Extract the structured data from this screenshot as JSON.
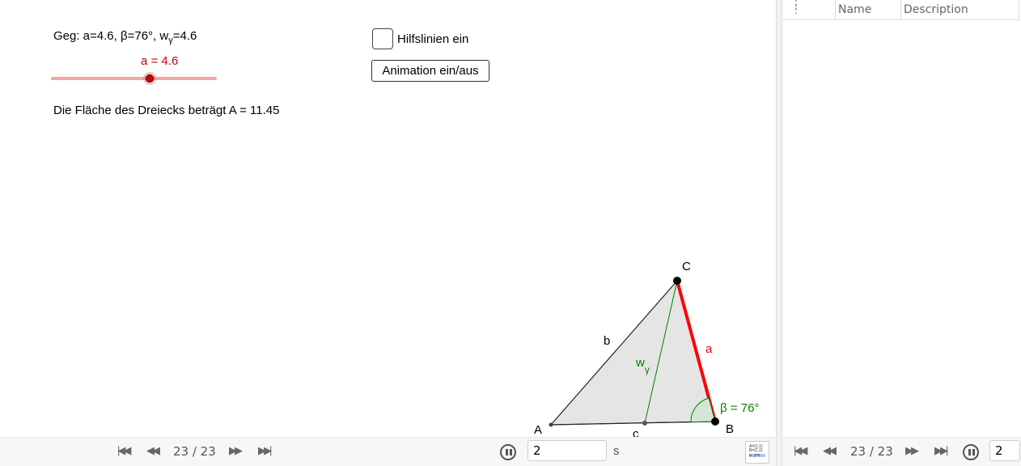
{
  "graphics": {
    "given_prefix": "Geg: a=4.6, β=76°, w",
    "given_sub": "γ",
    "given_suffix": "=4.6",
    "slider_label": "a = 4.6",
    "slider_value": 4.6,
    "area_text": "Die Fläche des Dreiecks beträgt A = 11.45",
    "checkbox_label": "Hilfslinien ein",
    "checkbox_checked": false,
    "animation_button": "Animation ein/aus",
    "points": {
      "A": "A",
      "B": "B",
      "C": "C"
    },
    "sides": {
      "a": "a",
      "b": "b",
      "c": "c"
    },
    "bisector_main": "w",
    "bisector_sub": "γ",
    "angle_label": "β = 76°",
    "colors": {
      "side_a": "#ff0000",
      "bisector": "#007f00",
      "slider_label": "#d00000",
      "fill": "#e5e5e5"
    }
  },
  "construction": {
    "headers": {
      "name": "Name",
      "description": "Description"
    }
  },
  "playbar": {
    "step": "23 / 23",
    "duration": "2",
    "unit": "s",
    "icons": [
      "first-step-icon",
      "previous-step-icon",
      "next-step-icon",
      "last-step-icon",
      "pause-icon"
    ]
  },
  "playbar2": {
    "step": "23 / 23",
    "duration": "2"
  }
}
